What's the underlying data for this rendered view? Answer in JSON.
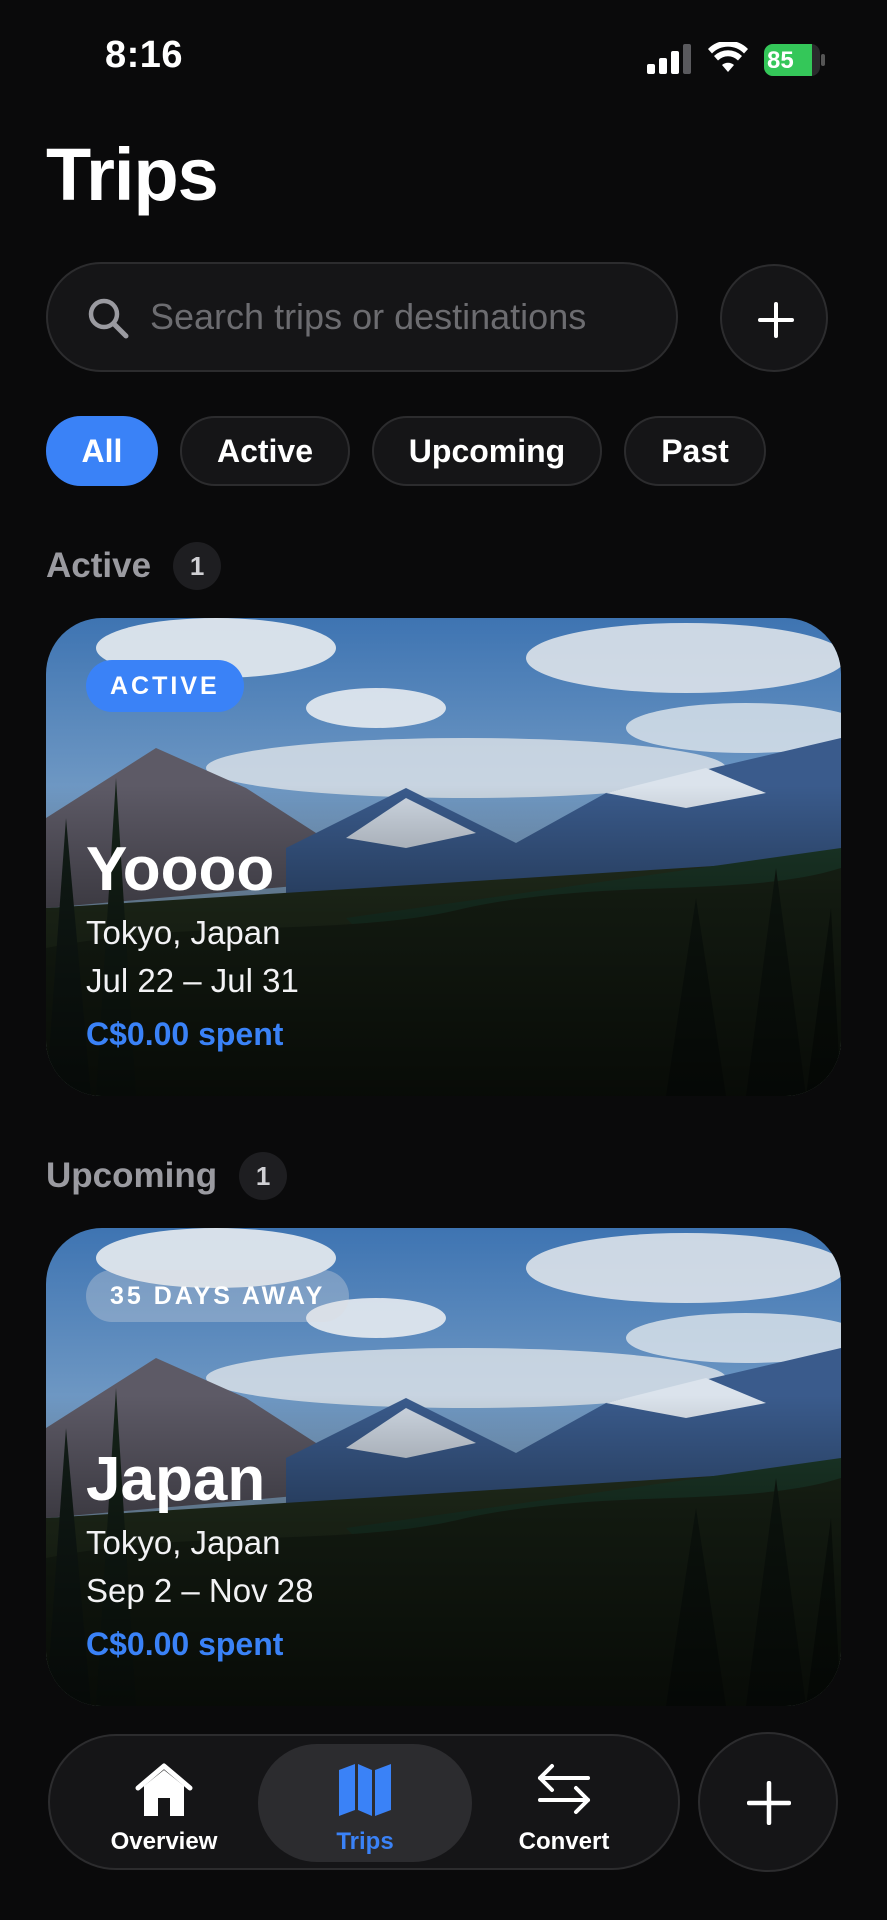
{
  "status_bar": {
    "time": "8:16",
    "battery": "85",
    "battery_level": 0.85
  },
  "header": {
    "title": "Trips"
  },
  "search": {
    "placeholder": "Search trips or destinations"
  },
  "filters": [
    "All",
    "Active",
    "Upcoming",
    "Past"
  ],
  "selected_filter": "All",
  "sections": [
    {
      "title": "Active",
      "count": "1",
      "trips": [
        {
          "badge": "ACTIVE",
          "name": "Yoooo",
          "location": "Tokyo, Japan",
          "dates": "Jul 22 – Jul 31",
          "spent": "C$0.00 spent"
        }
      ]
    },
    {
      "title": "Upcoming",
      "count": "1",
      "trips": [
        {
          "badge": "35 DAYS AWAY",
          "name": "Japan",
          "location": "Tokyo, Japan",
          "dates": "Sep 2 – Nov 28",
          "spent": "C$0.00 spent"
        }
      ]
    }
  ],
  "tab_bar": {
    "tabs": [
      {
        "label": "Overview",
        "icon": "house-icon"
      },
      {
        "label": "Trips",
        "icon": "map-icon"
      },
      {
        "label": "Convert",
        "icon": "arrows-swap-icon"
      }
    ],
    "selected": "Trips"
  },
  "colors": {
    "accent": "#3a82f7",
    "background": "#0a0a0b",
    "battery": "#34c759"
  }
}
